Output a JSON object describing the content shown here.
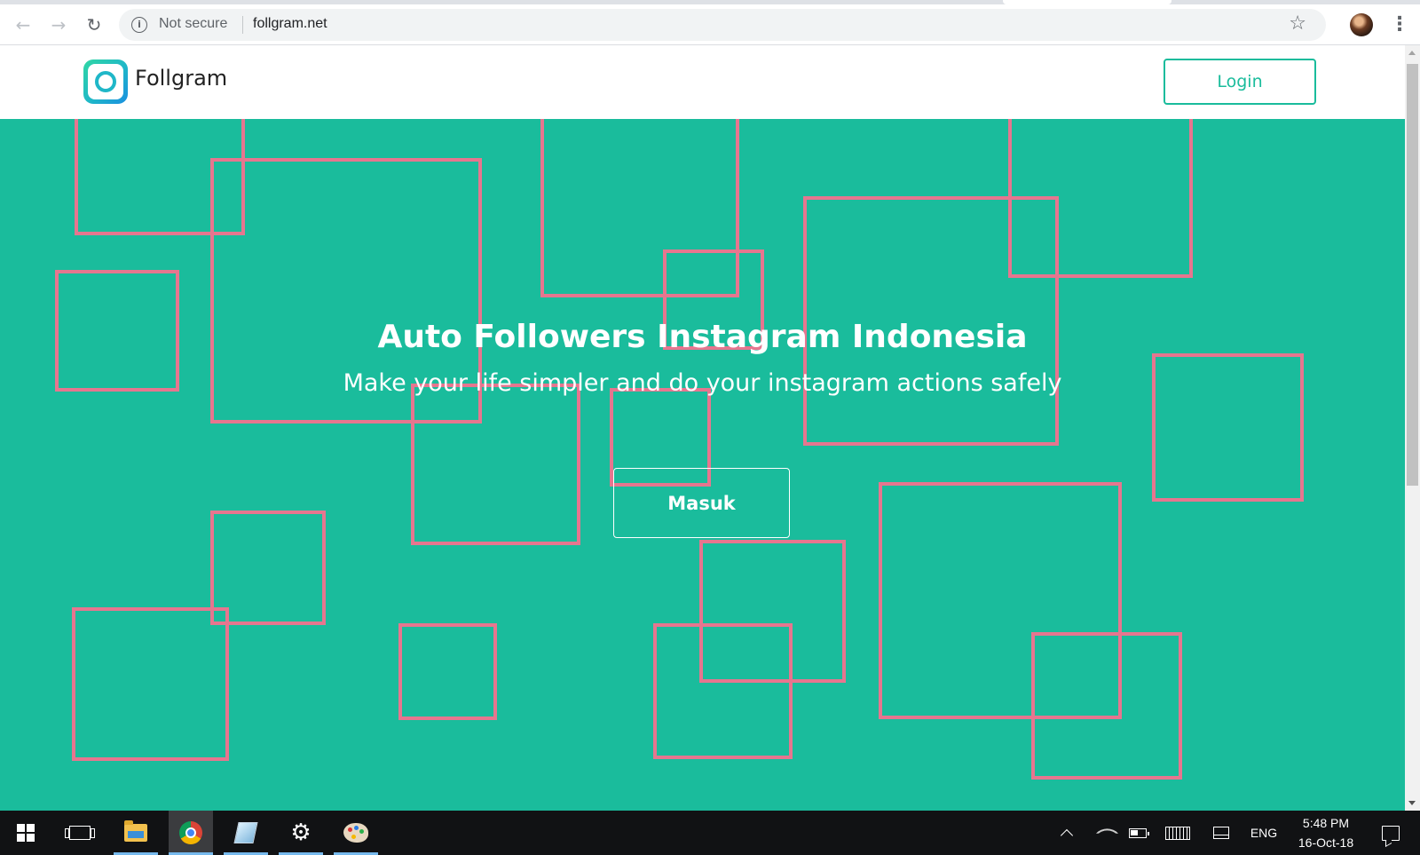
{
  "browser": {
    "back_icon": "back-arrow-icon",
    "forward_icon": "forward-arrow-icon",
    "reload_icon": "reload-icon",
    "security_label": "Not secure",
    "url": "follgram.net",
    "bookmark_icon": "star-icon",
    "menu_icon": "vertical-dots-icon"
  },
  "site": {
    "logo_text": "Follgram",
    "login_label": "Login"
  },
  "hero": {
    "title": "Auto Followers Instagram Indonesia",
    "subtitle": "Make your life simpler and do your instagram actions safely",
    "cta_label": "Masuk",
    "background_color": "#1abc9c",
    "square_outline_color": "#e6768f"
  },
  "taskbar": {
    "apps": [
      "start",
      "task-view",
      "file-explorer",
      "chrome",
      "notes",
      "settings",
      "paint"
    ],
    "language": "ENG",
    "time": "5:48 PM",
    "date": "16-Oct-18"
  }
}
